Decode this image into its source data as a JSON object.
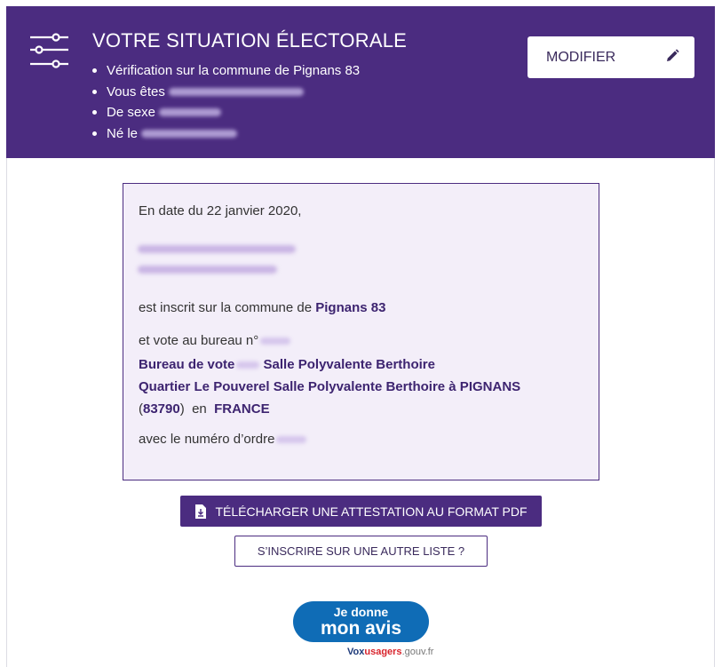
{
  "header": {
    "title": "VOTRE SITUATION ÉLECTORALE",
    "bullets": [
      {
        "label": "Vérification sur la commune de Pignans 83",
        "redacted": false
      },
      {
        "label": "Vous êtes",
        "redacted": true
      },
      {
        "label": "De sexe",
        "redacted": true
      },
      {
        "label": "Né le",
        "redacted": true
      }
    ],
    "modify_label": "MODIFIER"
  },
  "card": {
    "date_line": "En date du 22 janvier 2020,",
    "inscrit_prefix": "est inscrit sur la commune de",
    "commune": "Pignans 83",
    "bureau_prefix": "et vote au bureau n°",
    "bureau_name_prefix": "Bureau de vote",
    "bureau_name_suffix": "Salle Polyvalente Berthoire",
    "address": "Quartier Le Pouverel Salle Polyvalente Berthoire à PIGNANS",
    "postcode": "83790",
    "en": "en",
    "country": "FRANCE",
    "ordre_prefix": "avec le numéro d’ordre"
  },
  "actions": {
    "pdf_label": "TÉLÉCHARGER UNE ATTESTATION AU FORMAT PDF",
    "other_list_label": "S’INSCRIRE SUR UNE AUTRE LISTE ?"
  },
  "feedback": {
    "line1": "Je donne",
    "line2": "mon avis",
    "brand_part1": "Vox",
    "brand_part2": "usagers",
    "brand_part3": ".gouv.fr"
  },
  "colors": {
    "brand_purple": "#4b2c80",
    "card_bg": "#f3eef9",
    "feedback_blue": "#0f6cb6"
  }
}
